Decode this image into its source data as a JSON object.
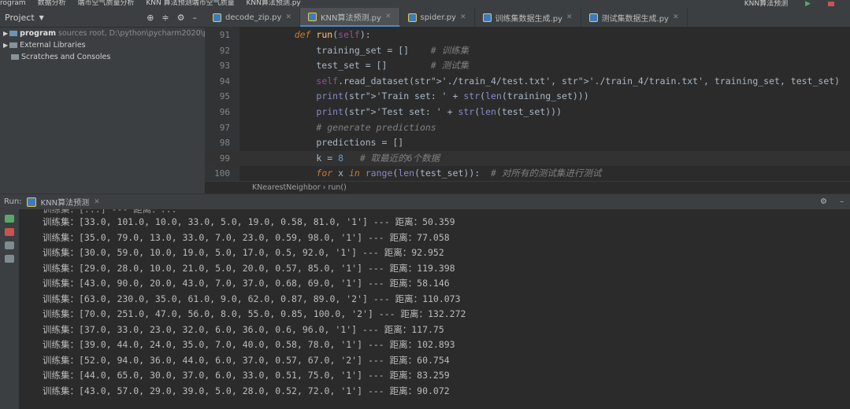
{
  "window": {
    "menu_fragments": [
      "rogram",
      "数据分析",
      "端市空气质量分析",
      "KNN 算法预测端市空气质量",
      "KNN算法预测.py"
    ],
    "run_config": "KNN算法预测"
  },
  "project_panel": {
    "title": "Project",
    "tree": [
      {
        "name": "program",
        "detail": "sources root, D:\\python\\pycharm2020\\progr"
      },
      {
        "name": "External Libraries",
        "detail": ""
      },
      {
        "name": "Scratches and Consoles",
        "detail": ""
      }
    ]
  },
  "tabs": [
    "decode_zip.py",
    "KNN算法预测.py",
    "spider.py",
    "训练集数据生成.py",
    "测试集数据生成.py"
  ],
  "editor": {
    "lines": [
      {
        "no": "91",
        "text": "    def run(self):"
      },
      {
        "no": "92",
        "text": "        training_set = []    # 训练集"
      },
      {
        "no": "93",
        "text": "        test_set = []        # 测试集"
      },
      {
        "no": "94",
        "text": "        self.read_dataset('./train_4/test.txt', './train_4/train.txt', training_set, test_set)  # 数据划分"
      },
      {
        "no": "95",
        "text": "        print('Train set: ' + str(len(training_set)))"
      },
      {
        "no": "96",
        "text": "        print('Test set: ' + str(len(test_set)))"
      },
      {
        "no": "97",
        "text": "        # generate predictions"
      },
      {
        "no": "98",
        "text": "        predictions = []"
      },
      {
        "no": "99",
        "text": "        k = 8   # 取最近的6个数据"
      },
      {
        "no": "100",
        "text": "        for x in range(len(test_set)):  # 对所有的测试集进行测试"
      }
    ],
    "breadcrumb": [
      "KNearestNeighbor",
      "run()"
    ]
  },
  "run_panel": {
    "label": "Run:",
    "tab": "KNN算法预测",
    "output": [
      "训练集：[33.0, 101.0, 10.0, 33.0, 5.0, 19.0, 0.58, 81.0, '1'] --- 距离：50.359",
      "训练集：[35.0, 79.0, 13.0, 33.0, 7.0, 23.0, 0.59, 98.0, '1'] --- 距离：77.058",
      "训练集：[30.0, 59.0, 10.0, 19.0, 5.0, 17.0, 0.5, 92.0, '1'] --- 距离：92.952",
      "训练集：[29.0, 28.0, 10.0, 21.0, 5.0, 20.0, 0.57, 85.0, '1'] --- 距离：119.398",
      "训练集：[43.0, 90.0, 20.0, 43.0, 7.0, 37.0, 0.68, 69.0, '1'] --- 距离：58.146",
      "训练集：[63.0, 230.0, 35.0, 61.0, 9.0, 62.0, 0.87, 89.0, '2'] --- 距离：110.073",
      "训练集：[70.0, 251.0, 47.0, 56.0, 8.0, 55.0, 0.85, 100.0, '2'] --- 距离：132.272",
      "训练集：[37.0, 33.0, 23.0, 32.0, 6.0, 36.0, 0.6, 96.0, '1'] --- 距离：117.75",
      "训练集：[39.0, 44.0, 24.0, 35.0, 7.0, 40.0, 0.58, 78.0, '1'] --- 距离：102.893",
      "训练集：[52.0, 94.0, 36.0, 44.0, 6.0, 37.0, 0.57, 67.0, '2'] --- 距离：60.754",
      "训练集：[44.0, 65.0, 30.0, 37.0, 6.0, 33.0, 0.51, 75.0, '1'] --- 距离：83.259",
      "训练集：[43.0, 57.0, 29.0, 39.0, 5.0, 28.0, 0.52, 72.0, '1'] --- 距离：90.072"
    ]
  }
}
